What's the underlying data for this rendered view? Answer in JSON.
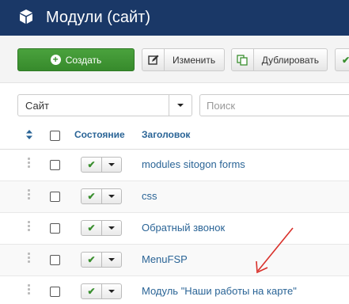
{
  "header": {
    "title": "Модули (сайт)",
    "logo_icon": "cube-icon",
    "background": "#1a3867"
  },
  "toolbar": {
    "create_label": "Создать",
    "edit_label": "Изменить",
    "duplicate_label": "Дублировать",
    "create_color": "#3f9a35"
  },
  "filters": {
    "site_value": "Сайт",
    "search_placeholder": "Поиск"
  },
  "table": {
    "columns": {
      "state": "Состояние",
      "title": "Заголовок"
    },
    "rows": [
      {
        "title": "modules sitogon forms"
      },
      {
        "title": "css"
      },
      {
        "title": "Обратный звонок"
      },
      {
        "title": "MenuFSP"
      },
      {
        "title": "Модуль \"Наши работы на карте\""
      }
    ]
  },
  "annotation": {
    "color": "#d9302a",
    "icon": "red-arrow-annotation"
  }
}
